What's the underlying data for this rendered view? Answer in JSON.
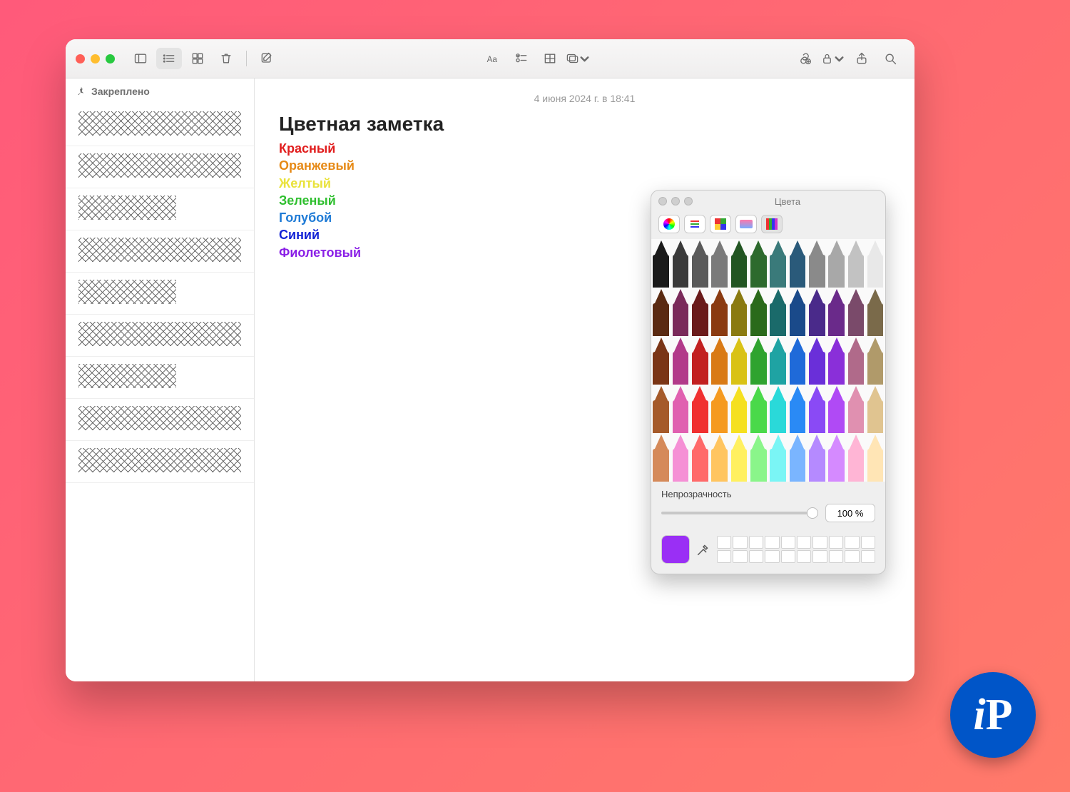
{
  "sidebar": {
    "pinned_label": "Закреплено"
  },
  "note": {
    "date": "4 июня 2024 г. в 18:41",
    "title": "Цветная заметка",
    "lines": [
      {
        "text": "Красный",
        "color": "#e11d1d"
      },
      {
        "text": "Оранжевый",
        "color": "#e68a17"
      },
      {
        "text": "Желтый",
        "color": "#e9e23b"
      },
      {
        "text": "Зеленый",
        "color": "#2fbf2f"
      },
      {
        "text": "Голубой",
        "color": "#1f7bd6"
      },
      {
        "text": "Синий",
        "color": "#1323d6"
      },
      {
        "text": "Фиолетовый",
        "color": "#8a1fe6"
      }
    ]
  },
  "picker": {
    "title": "Цвета",
    "opacity_label": "Непрозрачность",
    "opacity_value": "100 %",
    "selected_color": "#9a2ff5",
    "rows": [
      [
        "#1a1a1a",
        "#3a3a3a",
        "#5a5a5a",
        "#7a7a7a",
        "#225522",
        "#2d6a2d",
        "#3a7a7a",
        "#2a5a7a",
        "#8a8a8a",
        "#a8a8a8",
        "#c2c2c2",
        "#e8e8e8"
      ],
      [
        "#5a2a12",
        "#7a2a5a",
        "#6a1a1a",
        "#8a3a10",
        "#8a7a10",
        "#2a6a1a",
        "#1a6a6a",
        "#1a4a8a",
        "#4a2a8a",
        "#6a2a8a",
        "#7a4a6a",
        "#7a6a4a"
      ],
      [
        "#7a3516",
        "#b23a8a",
        "#c22020",
        "#d97a15",
        "#d9c215",
        "#2fa32f",
        "#1fa3a3",
        "#1f6ad9",
        "#6a2fd9",
        "#8a2fd9",
        "#b06a8a",
        "#b09a6a"
      ],
      [
        "#a55a2a",
        "#e060b0",
        "#f03030",
        "#f59a20",
        "#f5e020",
        "#4ad94a",
        "#2ad9d9",
        "#2a8af5",
        "#8a4af5",
        "#b04af5",
        "#e090b0",
        "#e0c490"
      ],
      [
        "#d58a5a",
        "#f590d5",
        "#ff6a6a",
        "#ffc560",
        "#fff060",
        "#8af58a",
        "#7af5f5",
        "#7ab5ff",
        "#b58aff",
        "#d58aff",
        "#ffb5d5",
        "#ffe5b5"
      ]
    ]
  },
  "badge": {
    "text_i": "i",
    "text_p": "P"
  }
}
